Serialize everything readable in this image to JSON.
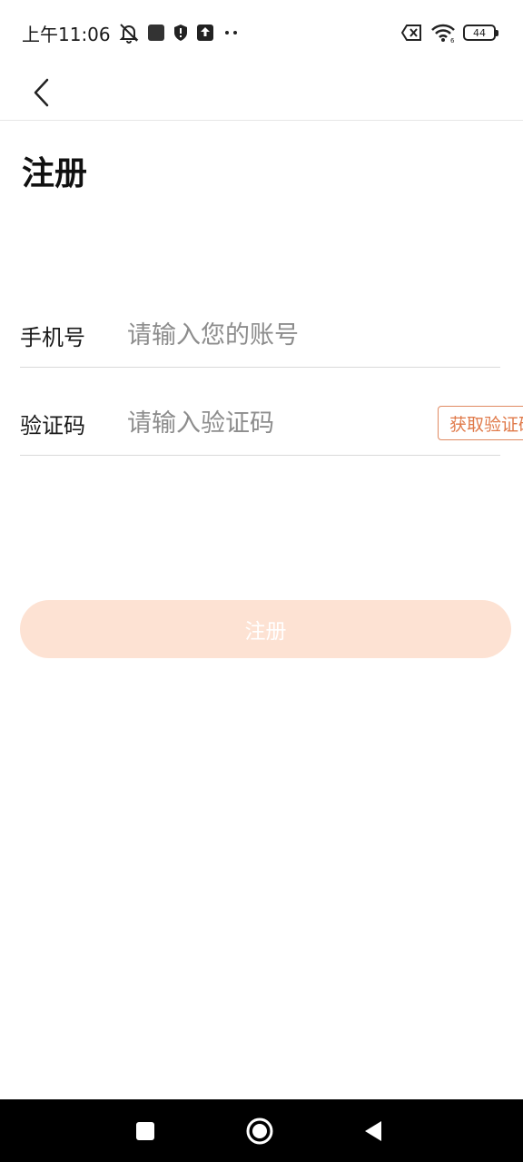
{
  "status_bar": {
    "time": "上午11:06",
    "battery_level": "44",
    "icons": [
      "mute-bell-icon",
      "app-square-icon",
      "shield-icon",
      "upload-icon",
      "more-dots-icon",
      "sim-error-icon",
      "wifi-icon",
      "battery-icon"
    ]
  },
  "app_bar": {
    "back_icon": "chevron-left-icon"
  },
  "page": {
    "title": "注册"
  },
  "form": {
    "phone": {
      "label": "手机号",
      "value": "",
      "placeholder": "请输入您的账号"
    },
    "code": {
      "label": "验证码",
      "value": "",
      "placeholder": "请输入验证码",
      "get_code_label": "获取验证码"
    }
  },
  "register_button": {
    "label": "注册",
    "enabled": false
  },
  "colors": {
    "accent": "#e07a4a",
    "register_bg_disabled": "#fde2d3",
    "nav_bar_bg": "#000000"
  },
  "nav_bar": {
    "icons": [
      "square-recents-icon",
      "circle-home-icon",
      "triangle-back-icon"
    ]
  }
}
